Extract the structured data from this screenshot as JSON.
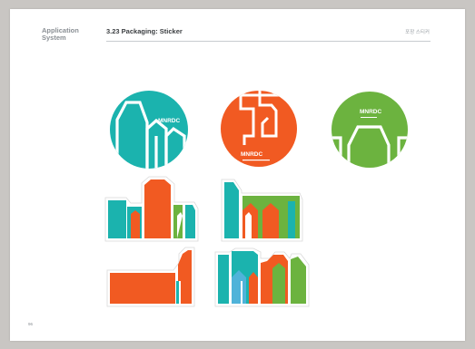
{
  "header": {
    "section_label": "Application System",
    "page_title": "3.23 Packaging: Sticker",
    "korean_tag": "포장 스티커"
  },
  "footer": {
    "page_number": "96"
  },
  "stickers": {
    "brand_text": "MNRDC"
  },
  "colors": {
    "teal": "#1bb3ae",
    "orange": "#f15a22",
    "green": "#6cb33f",
    "sky": "#4fb3d9",
    "white": "#ffffff"
  }
}
